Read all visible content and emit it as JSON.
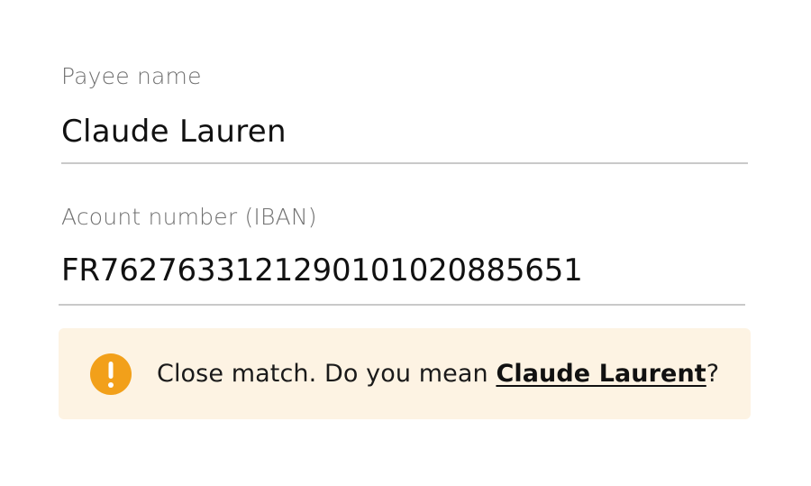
{
  "payee": {
    "label": "Payee name",
    "value": "Claude Lauren"
  },
  "account": {
    "label": "Acount number (IBAN)",
    "value": "FR7627633121290101020885651"
  },
  "alert": {
    "icon": "exclamation-icon",
    "icon_color": "#f2a01a",
    "background_color": "#fdf3e3",
    "message": "Close match. Do you mean ",
    "suggestion": "Claude Laurent",
    "suffix": "?"
  }
}
